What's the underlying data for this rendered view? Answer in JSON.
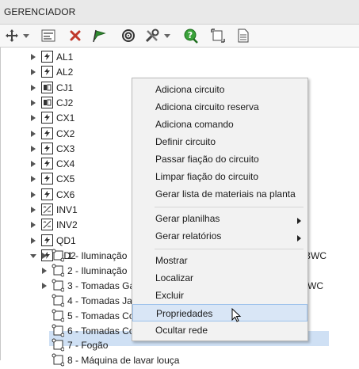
{
  "window": {
    "title": "GERENCIADOR"
  },
  "toolbar": {
    "buttons": [
      {
        "icon": "move-icon"
      },
      {
        "icon": "chevron-down-icon"
      },
      {
        "icon": "panel-icon"
      },
      {
        "icon": "delete-x-icon"
      },
      {
        "icon": "flag-icon"
      },
      {
        "icon": "target-icon"
      },
      {
        "icon": "tools-icon"
      },
      {
        "icon": "chevron-down-icon"
      },
      {
        "icon": "help-icon"
      },
      {
        "icon": "frame-icon"
      },
      {
        "icon": "document-icon"
      }
    ]
  },
  "tree": {
    "nodes": [
      {
        "label": "AL1",
        "icon": "board-icon",
        "expanded": false
      },
      {
        "label": "AL2",
        "icon": "board-icon",
        "expanded": false
      },
      {
        "label": "CJ1",
        "icon": "assembly-icon",
        "expanded": false
      },
      {
        "label": "CJ2",
        "icon": "assembly-icon",
        "expanded": false
      },
      {
        "label": "CX1",
        "icon": "board-icon",
        "expanded": false
      },
      {
        "label": "CX2",
        "icon": "board-icon",
        "expanded": false
      },
      {
        "label": "CX3",
        "icon": "board-icon",
        "expanded": false
      },
      {
        "label": "CX4",
        "icon": "board-icon",
        "expanded": false
      },
      {
        "label": "CX5",
        "icon": "board-icon",
        "expanded": false
      },
      {
        "label": "CX6",
        "icon": "board-icon",
        "expanded": false
      },
      {
        "label": "INV1",
        "icon": "inverter-icon",
        "expanded": false
      },
      {
        "label": "INV2",
        "icon": "inverter-icon",
        "expanded": false
      },
      {
        "label": "QD1",
        "icon": "board-icon",
        "expanded": false
      },
      {
        "label": "QD2",
        "icon": "board-icon",
        "expanded": true
      }
    ],
    "circuits": [
      {
        "label": "1 - Iluminação",
        "tail": "BWC",
        "has_children": true
      },
      {
        "label": "2 - Iluminação",
        "tail": "",
        "has_children": true
      },
      {
        "label": "3 - Tomadas Ga",
        "tail": "WC",
        "has_children": true
      },
      {
        "label": "4 - Tomadas Ja",
        "tail": "",
        "has_children": false
      },
      {
        "label": "5 - Tomadas Co",
        "tail": "",
        "has_children": false
      },
      {
        "label": "6 - Tomadas Co",
        "tail": "",
        "has_children": false
      },
      {
        "label": "7 - Fogão",
        "tail": "",
        "has_children": false,
        "selected": true
      },
      {
        "label": "8 - Máquina de lavar louça",
        "tail": "",
        "has_children": false
      }
    ]
  },
  "context_menu": {
    "groups": [
      [
        {
          "label": "Adiciona circuito"
        },
        {
          "label": "Adiciona circuito reserva"
        },
        {
          "label": "Adiciona comando"
        },
        {
          "label": "Definir circuito"
        },
        {
          "label": "Passar fiação do circuito"
        },
        {
          "label": "Limpar fiação do circuito"
        },
        {
          "label": "Gerar lista de materiais na planta"
        }
      ],
      [
        {
          "label": "Gerar planilhas",
          "submenu": true
        },
        {
          "label": "Gerar relatórios",
          "submenu": true
        }
      ],
      [
        {
          "label": "Mostrar"
        },
        {
          "label": "Localizar"
        },
        {
          "label": "Excluir"
        },
        {
          "label": "Propriedades",
          "highlighted": true
        },
        {
          "label": "Ocultar rede"
        }
      ]
    ]
  },
  "colors": {
    "selection": "#cfe0f4",
    "menu_background": "#f2f2f2",
    "menu_highlight": "#d9e6f6",
    "flag_green": "#2e8b2e",
    "help_green": "#3aa23a",
    "delete_red": "#c0392b"
  }
}
